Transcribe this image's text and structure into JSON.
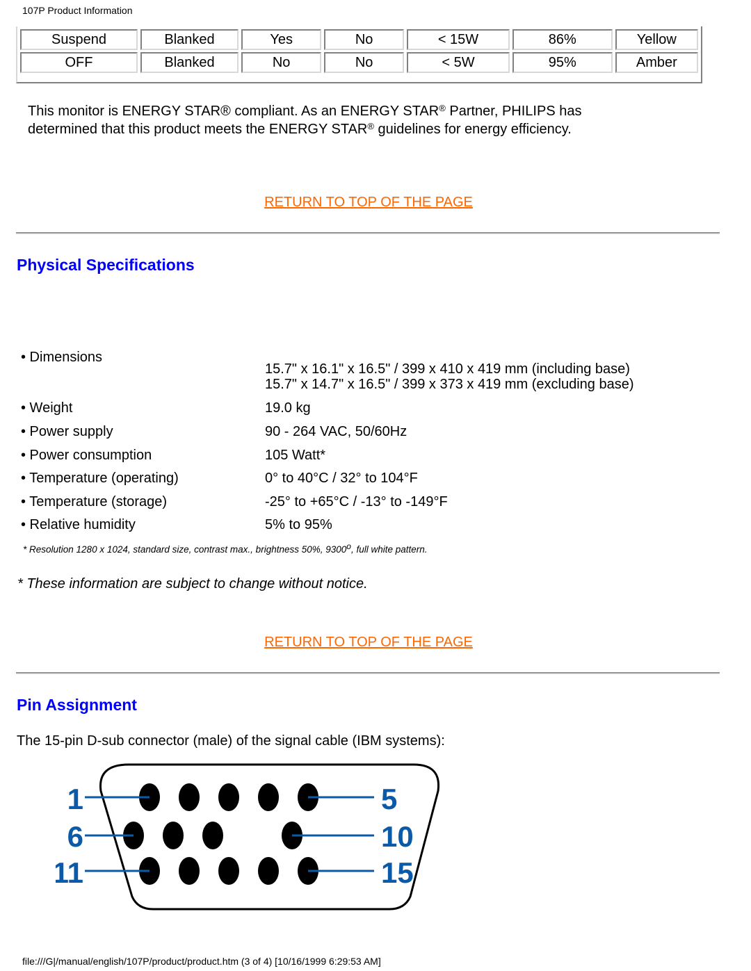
{
  "header": {
    "title": "107P Product Information"
  },
  "power_table": {
    "rows": [
      [
        "Suspend",
        "Blanked",
        "Yes",
        "No",
        "< 15W",
        "86%",
        "Yellow"
      ],
      [
        "OFF",
        "Blanked",
        "No",
        "No",
        "< 5W",
        "95%",
        "Amber"
      ]
    ]
  },
  "energy_star": {
    "part1": "This monitor is ENERGY STAR® compliant. As an ENERGY STAR",
    "reg1": "®",
    "part2": " Partner, PHILIPS has determined that this product meets the ENERGY STAR",
    "reg2": "®",
    "part3": " guidelines for energy efficiency."
  },
  "links": {
    "return_top": "RETURN TO TOP OF THE PAGE"
  },
  "physical": {
    "heading": "Physical Specifications",
    "specs": [
      {
        "label": "• Dimensions",
        "values": [
          "15.7\" x 16.1\" x 16.5\" / 399 x 410 x 419 mm (including base)",
          "15.7\" x 14.7\" x 16.5\" / 399 x 373 x 419 mm (excluding base)"
        ]
      },
      {
        "label": "• Weight",
        "values": [
          "19.0 kg"
        ]
      },
      {
        "label": "• Power supply",
        "values": [
          "90 - 264 VAC, 50/60Hz"
        ]
      },
      {
        "label": "• Power consumption",
        "values": [
          "105 Watt*"
        ]
      },
      {
        "label": "• Temperature (operating)",
        "values": [
          "0° to 40°C / 32° to 104°F"
        ]
      },
      {
        "label": "• Temperature (storage)",
        "values": [
          "-25° to +65°C / -13° to -149°F"
        ]
      },
      {
        "label": "• Relative humidity",
        "values": [
          "5% to 95%"
        ]
      }
    ],
    "footnote_pre": "* Resolution 1280 x 1024, standard size, contrast max., brightness 50%, 9300",
    "footnote_deg": "o",
    "footnote_post": ", full white pattern.",
    "notice": "* These information are subject to change without notice."
  },
  "pin": {
    "heading": "Pin Assignment",
    "intro": "The 15-pin D-sub connector (male) of the signal cable (IBM systems):",
    "diagram": {
      "labels_left": [
        "1",
        "6",
        "11"
      ],
      "labels_right": [
        "5",
        "10",
        "15"
      ],
      "row_pin_counts": [
        5,
        4,
        5
      ],
      "label_color": "#0b5aa8",
      "pin_color": "#000000"
    }
  },
  "footer": {
    "url": "file:///G|/manual/english/107P/product/product.htm (3 of 4) [10/16/1999 6:29:53 AM]"
  },
  "colors": {
    "heading": "#0000ff",
    "link": "#ff6600"
  }
}
